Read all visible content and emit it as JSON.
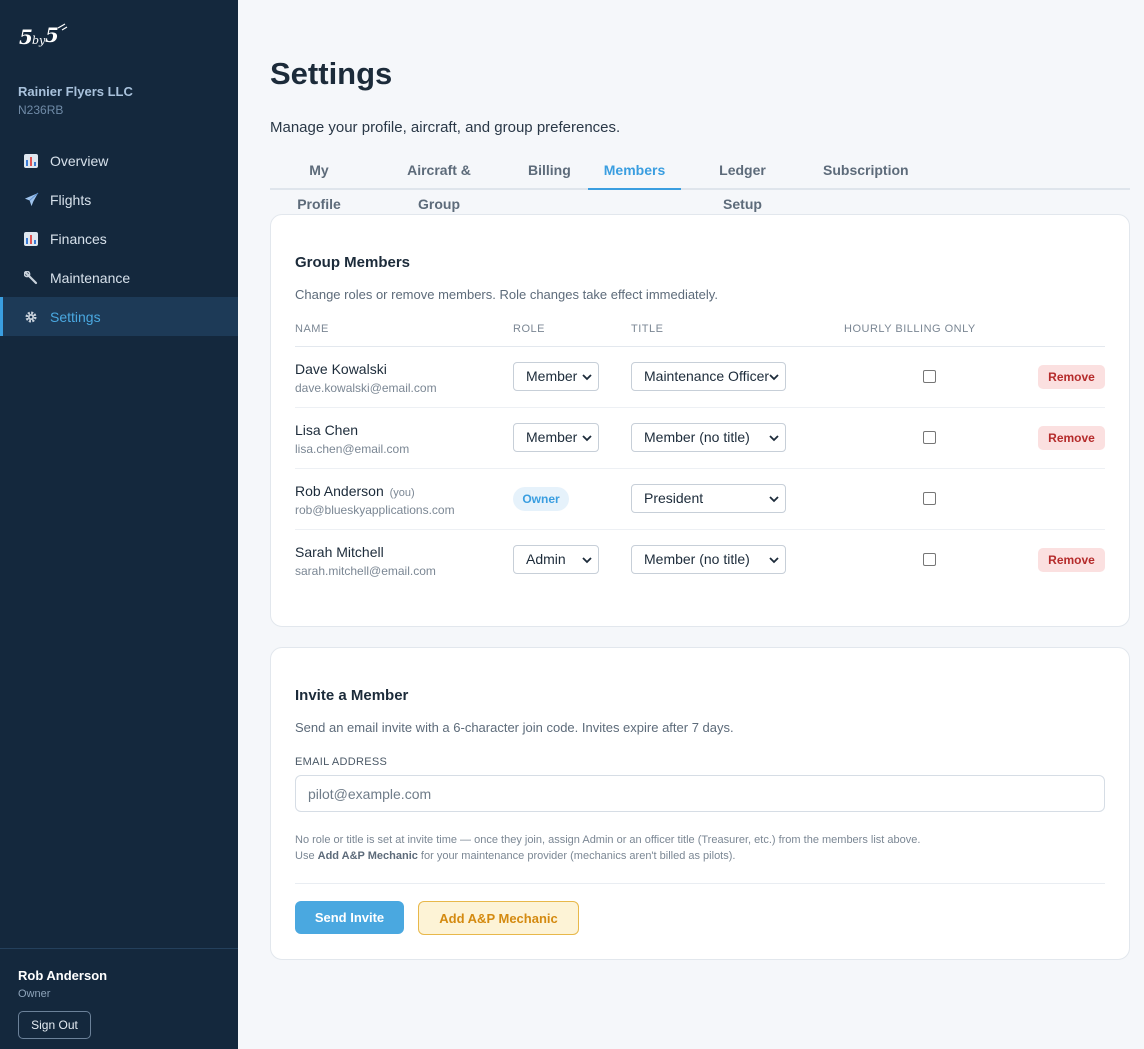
{
  "brand": {
    "logo_text": "5by5"
  },
  "org": {
    "name": "Rainier Flyers LLC",
    "tail_number": "N236RB"
  },
  "nav": [
    {
      "label": "Overview",
      "icon": "bar-chart-icon"
    },
    {
      "label": "Flights",
      "icon": "airplane-icon"
    },
    {
      "label": "Finances",
      "icon": "bar-chart-icon"
    },
    {
      "label": "Maintenance",
      "icon": "wrench-icon"
    },
    {
      "label": "Settings",
      "icon": "gear-icon"
    }
  ],
  "user": {
    "name": "Rob Anderson",
    "role": "Owner",
    "signout_label": "Sign Out"
  },
  "page": {
    "title": "Settings",
    "subtitle": "Manage your profile, aircraft, and group preferences."
  },
  "tabs": [
    "My Profile",
    "Aircraft & Group",
    "Billing",
    "Members",
    "Ledger Setup",
    "Subscription"
  ],
  "active_tab": "Members",
  "members_card": {
    "title": "Group Members",
    "description": "Change roles or remove members. Role changes take effect immediately.",
    "columns": {
      "name": "NAME",
      "role": "ROLE",
      "title": "TITLE",
      "hourly": "HOURLY BILLING ONLY"
    },
    "remove_label": "Remove",
    "owner_label": "Owner",
    "you_label": "(you)",
    "members": [
      {
        "name": "Dave Kowalski",
        "email": "dave.kowalski@email.com",
        "role": "Member",
        "title": "Maintenance Officer",
        "hourly_only": false,
        "is_owner": false,
        "is_you": false
      },
      {
        "name": "Lisa Chen",
        "email": "lisa.chen@email.com",
        "role": "Member",
        "title": "Member (no title)",
        "hourly_only": false,
        "is_owner": false,
        "is_you": false
      },
      {
        "name": "Rob Anderson",
        "email": "rob@blueskyapplications.com",
        "role": "Owner",
        "title": "President",
        "hourly_only": false,
        "is_owner": true,
        "is_you": true
      },
      {
        "name": "Sarah Mitchell",
        "email": "sarah.mitchell@email.com",
        "role": "Admin",
        "title": "Member (no title)",
        "hourly_only": false,
        "is_owner": false,
        "is_you": false
      }
    ]
  },
  "invite_card": {
    "title": "Invite a Member",
    "description": "Send an email invite with a 6-character join code. Invites expire after 7 days.",
    "email_label": "EMAIL ADDRESS",
    "email_placeholder": "pilot@example.com",
    "email_value": "",
    "hint_line1": "No role or title is set at invite time — once they join, assign Admin or an officer title (Treasurer, etc.) from the members list above.",
    "hint_line2_prefix": "Use ",
    "hint_line2_bold": "Add A&P Mechanic",
    "hint_line2_suffix": " for your maintenance provider (mechanics aren't billed as pilots).",
    "send_label": "Send Invite",
    "mechanic_label": "Add A&P Mechanic"
  },
  "colors": {
    "accent": "#3a9ee0",
    "sidebar": "#14283d",
    "danger_bg": "#fbe0e0",
    "danger_text": "#b52b2b",
    "warning_bg": "#fdf3d6",
    "warning_text": "#d48a10"
  }
}
